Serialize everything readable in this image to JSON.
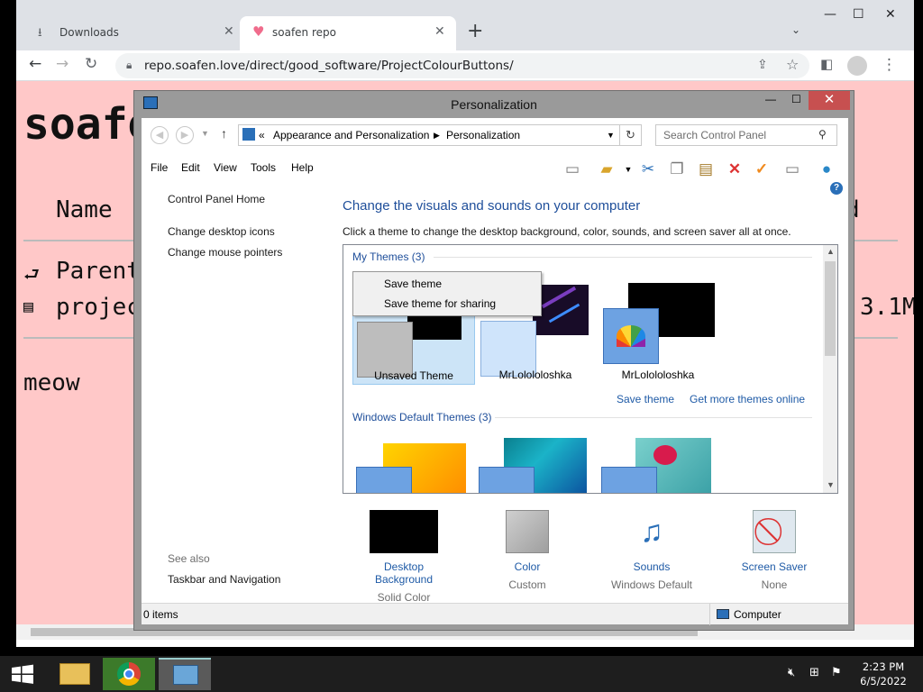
{
  "browser": {
    "tabs": [
      {
        "label": "Downloads",
        "icon": "download-icon"
      },
      {
        "label": "soafen repo",
        "icon": "heart-icon"
      }
    ],
    "new_tab": "+",
    "url": "repo.soafen.love/direct/good_software/ProjectColourButtons/"
  },
  "page": {
    "title": "soafe",
    "name_header": "Name",
    "header_right": "d",
    "row1": "Parent",
    "row2": "projec",
    "row2_size": "3.1M",
    "footer": "meow",
    "bg_color": "#ffc8c8"
  },
  "window": {
    "title": "Personalization",
    "close": "✕",
    "breadcrumb": [
      "Appearance and Personalization",
      "Personalization"
    ],
    "breadcrumb_prefix": "«",
    "search_placeholder": "Search Control Panel",
    "menu": [
      "File",
      "Edit",
      "View",
      "Tools",
      "Help"
    ],
    "sidebar": {
      "home": "Control Panel Home",
      "links": [
        "Change desktop icons",
        "Change mouse pointers"
      ],
      "see_also": "See also",
      "see_also_link": "Taskbar and Navigation"
    },
    "heading": "Change the visuals and sounds on your computer",
    "subheading": "Click a theme to change the desktop background, color, sounds, and screen saver all at once.",
    "my_themes": {
      "label": "My Themes (3)",
      "items": [
        "Unsaved Theme",
        "MrLolololoshka",
        "MrLolololoshka"
      ],
      "save_link": "Save theme",
      "more_link": "Get more themes online"
    },
    "default_themes": {
      "label": "Windows Default Themes (3)"
    },
    "context_menu": [
      "Save theme",
      "Save theme for sharing"
    ],
    "bottom": [
      {
        "label": "Desktop Background",
        "value": "Solid Color"
      },
      {
        "label": "Color",
        "value": "Custom"
      },
      {
        "label": "Sounds",
        "value": "Windows Default"
      },
      {
        "label": "Screen Saver",
        "value": "None"
      }
    ],
    "status_left": "0 items",
    "status_right": "Computer"
  },
  "taskbar": {
    "time": "2:23 PM",
    "date": "6/5/2022"
  }
}
